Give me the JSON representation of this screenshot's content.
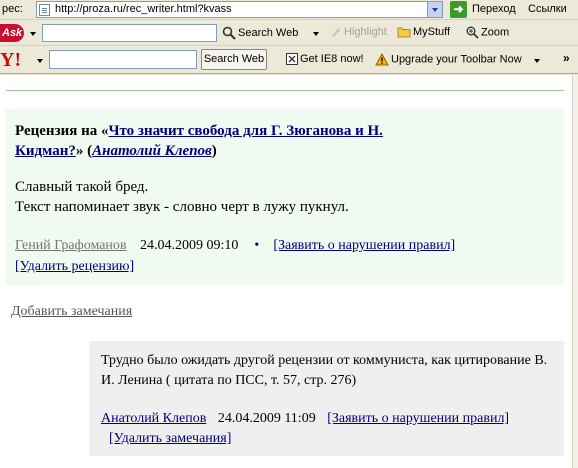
{
  "browser": {
    "address_label": "рес:",
    "url": "http://proza.ru/rec_writer.html?kvass",
    "go_label": "Переход",
    "links_label": "Ссылки"
  },
  "ask_toolbar": {
    "logo": "Ask",
    "search_value": "",
    "search_web": "Search Web",
    "highlight": "Highlight",
    "mystuff": "MyStuff",
    "zoom": "Zoom"
  },
  "yahoo_toolbar": {
    "logo": "Y!",
    "search_value": "",
    "search_button": "Search Web",
    "get_ie8": "Get IE8 now!",
    "upgrade": "Upgrade your Toolbar Now"
  },
  "review": {
    "prefix": "Рецензия на «",
    "work_title": "Что значит свобода для Г. Зюганова и Н. Кидман?",
    "mid": "» (",
    "work_author": "Анатолий Клепов",
    "suffix": ")",
    "body_line1": "Славный такой бред.",
    "body_line2": "Текст напоминает звук - словно черт в лужу пукнул.",
    "reviewer": "Гений Графоманов",
    "datetime": "24.04.2009 09:10",
    "separator": "•",
    "report_link": "[Заявить о нарушении правил]",
    "delete_link": "[Удалить рецензию]"
  },
  "add_note": "Добавить замечания",
  "reply": {
    "body": "Трудно было ожидать другой рецензии от коммуниста, как цитирование В. И. Ленина ( цитата по ПСС, т. 57, стр. 276)",
    "author": "Анатолий Клепов",
    "datetime": "24.04.2009 11:09",
    "report_link": "[Заявить о нарушении правил]",
    "delete_link": "[Удалить замечания]"
  }
}
